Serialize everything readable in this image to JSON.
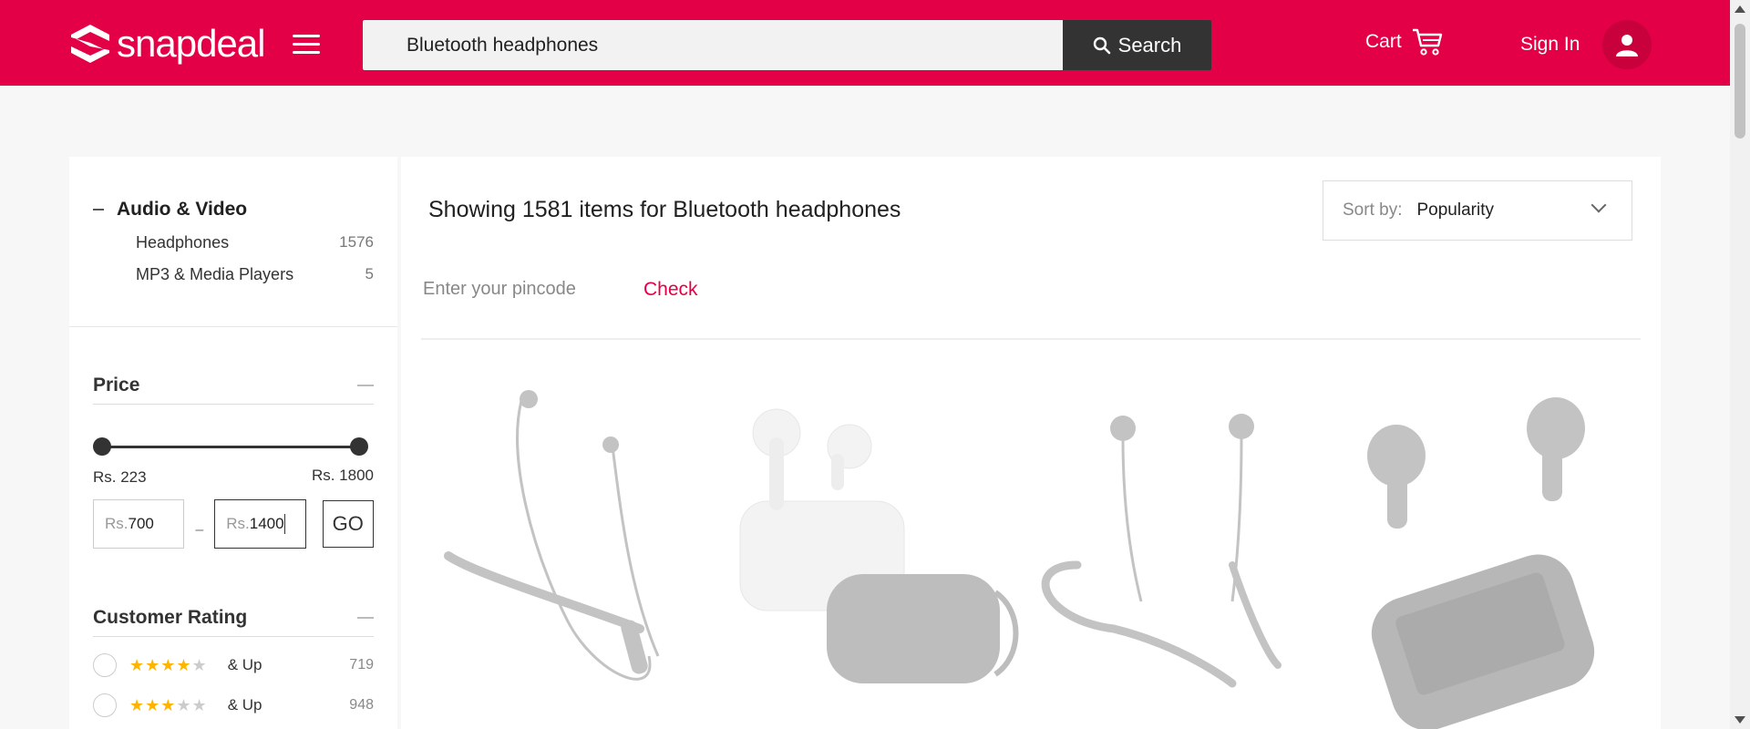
{
  "header": {
    "logo_text": "snapdeal",
    "search_value": "Bluetooth headphones",
    "search_button": "Search",
    "cart_label": "Cart",
    "signin_label": "Sign In"
  },
  "sidebar": {
    "category": {
      "title": "Audio & Video",
      "items": [
        {
          "label": "Headphones",
          "count": "1576"
        },
        {
          "label": "MP3 & Media Players",
          "count": "5"
        }
      ]
    },
    "price": {
      "title": "Price",
      "min_label": "Rs. 223",
      "max_label": "Rs. 1800",
      "currency_prefix": "Rs.",
      "min_value": "700",
      "max_value": "1400",
      "go_label": "GO"
    },
    "rating": {
      "title": "Customer Rating",
      "rows": [
        {
          "stars": 4,
          "label": "& Up",
          "count": "719"
        },
        {
          "stars": 3,
          "label": "& Up",
          "count": "948"
        }
      ]
    }
  },
  "main": {
    "showing_text": "Showing 1581 items for Bluetooth headphones",
    "sort_label": "Sort by:",
    "sort_value": "Popularity",
    "pincode_placeholder": "Enter your pincode",
    "check_label": "Check"
  },
  "colors": {
    "brand": "#e40046",
    "dark_button": "#333333",
    "star": "#ffb400"
  },
  "icons": [
    "snapdeal-logo-icon",
    "menu-icon",
    "search-icon",
    "cart-icon",
    "user-icon",
    "minus-icon",
    "chevron-down-icon"
  ]
}
